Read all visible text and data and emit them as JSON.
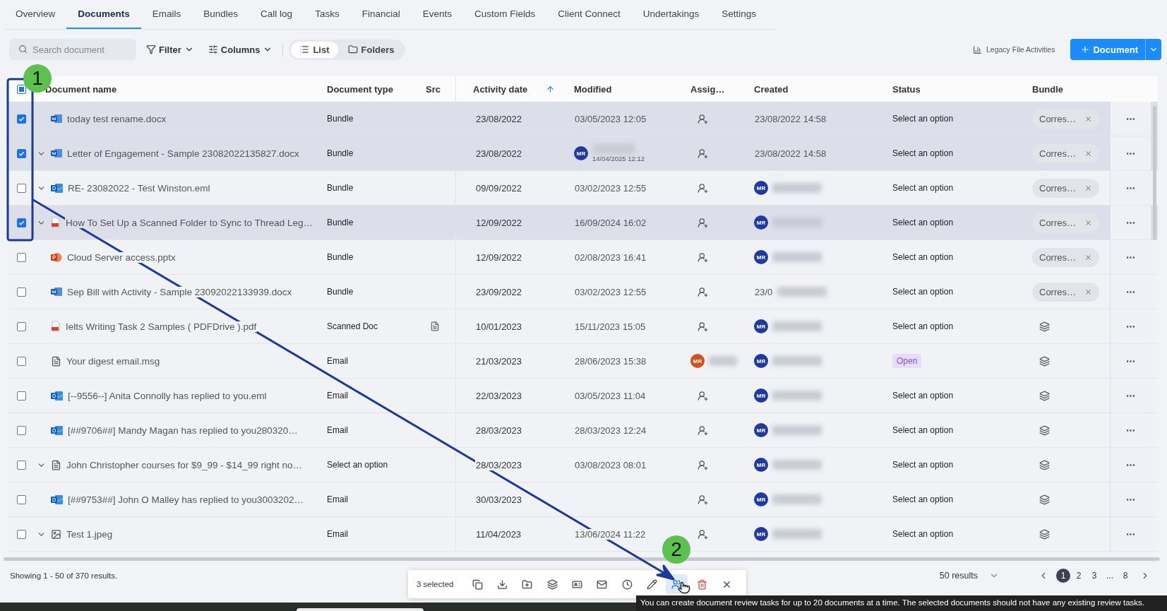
{
  "tabs": [
    {
      "label": "Overview",
      "selected": false
    },
    {
      "label": "Documents",
      "selected": true
    },
    {
      "label": "Emails",
      "selected": false
    },
    {
      "label": "Bundles",
      "selected": false
    },
    {
      "label": "Call log",
      "selected": false
    },
    {
      "label": "Tasks",
      "selected": false
    },
    {
      "label": "Financial",
      "selected": false
    },
    {
      "label": "Events",
      "selected": false
    },
    {
      "label": "Custom Fields",
      "selected": false
    },
    {
      "label": "Client Connect",
      "selected": false
    },
    {
      "label": "Undertakings",
      "selected": false
    },
    {
      "label": "Settings",
      "selected": false
    }
  ],
  "toolbar": {
    "search": {
      "placeholder": "Search document"
    },
    "filter": "Filter",
    "columns": "Columns",
    "views": [
      {
        "label": "List",
        "selected": true
      },
      {
        "label": "Folders",
        "selected": false
      }
    ],
    "legacy": "Legacy File Activities",
    "new_button": "Document"
  },
  "table": {
    "select_all": {
      "checked": true,
      "partial": true
    },
    "columns": [
      "Document name",
      "Document type",
      "Src",
      "Activity date",
      "Modified",
      "Assig…",
      "Created",
      "Status",
      "Bundle"
    ],
    "rows": [
      {
        "selected": true,
        "expandable": false,
        "kind": "word",
        "name": "today test rename.docx",
        "type": "Bundle",
        "src": false,
        "activity": "23/08/2022",
        "modified": {
          "kind": "plain",
          "text": "03/05/2023 12:05"
        },
        "assignee": {
          "kind": "add"
        },
        "created": {
          "kind": "plain",
          "text": "23/08/2022 14:58"
        },
        "status": {
          "kind": "select",
          "text": "Select an option"
        },
        "bundle": {
          "kind": "chip",
          "text": "Corres…"
        }
      },
      {
        "selected": true,
        "expandable": true,
        "kind": "word",
        "name": "Letter of Engagement - Sample 23082022135827.docx",
        "type": "Bundle",
        "src": false,
        "activity": "23/08/2022",
        "modified": {
          "kind": "user",
          "avatar": "MR",
          "text": "14/04/2025 12:12"
        },
        "assignee": {
          "kind": "add"
        },
        "created": {
          "kind": "plain",
          "text": "23/08/2022 14:58"
        },
        "status": {
          "kind": "select",
          "text": "Select an option"
        },
        "bundle": {
          "kind": "chip",
          "text": "Corres…"
        }
      },
      {
        "selected": false,
        "expandable": true,
        "kind": "outlook",
        "name": "RE- 23082022 - Test Winston.eml",
        "type": "Bundle",
        "src": false,
        "activity": "09/09/2022",
        "modified": {
          "kind": "plain",
          "text": "03/02/2023 12:55"
        },
        "assignee": {
          "kind": "add"
        },
        "created": {
          "kind": "user",
          "avatar": "MR"
        },
        "status": {
          "kind": "select",
          "text": "Select an option"
        },
        "bundle": {
          "kind": "chip",
          "text": "Corres…"
        }
      },
      {
        "selected": true,
        "expandable": true,
        "kind": "pdf",
        "name": "How To Set Up a Scanned Folder to Sync to Thread Leg…",
        "type": "Bundle",
        "src": false,
        "activity": "12/09/2022",
        "modified": {
          "kind": "plain",
          "text": "16/09/2024 16:02"
        },
        "assignee": {
          "kind": "add"
        },
        "created": {
          "kind": "user",
          "avatar": "MR"
        },
        "status": {
          "kind": "select",
          "text": "Select an option"
        },
        "bundle": {
          "kind": "chip",
          "text": "Corres…"
        }
      },
      {
        "selected": false,
        "expandable": false,
        "kind": "powerpoint",
        "name": "Cloud Server access.pptx",
        "type": "Bundle",
        "src": false,
        "activity": "12/09/2022",
        "modified": {
          "kind": "plain",
          "text": "02/08/2023 16:41"
        },
        "assignee": {
          "kind": "add"
        },
        "created": {
          "kind": "user",
          "avatar": "MR"
        },
        "status": {
          "kind": "select",
          "text": "Select an option"
        },
        "bundle": {
          "kind": "chip",
          "text": "Corres…"
        }
      },
      {
        "selected": false,
        "expandable": false,
        "kind": "word",
        "name": "Sep Bill with Activity - Sample 23092022133939.docx",
        "type": "Bundle",
        "src": false,
        "activity": "23/09/2022",
        "modified": {
          "kind": "plain",
          "text": "03/02/2023 12:55"
        },
        "assignee": {
          "kind": "add"
        },
        "created": {
          "kind": "partial",
          "text": "23/0"
        },
        "status": {
          "kind": "select",
          "text": "Select an option"
        },
        "bundle": {
          "kind": "chip",
          "text": "Corres…"
        }
      },
      {
        "selected": false,
        "expandable": false,
        "kind": "pdf",
        "name": "Ielts Writing Task 2 Samples ( PDFDrive ).pdf",
        "type": "Scanned Doc",
        "src": true,
        "activity": "10/01/2023",
        "modified": {
          "kind": "plain",
          "text": "15/11/2023 15:05"
        },
        "assignee": {
          "kind": "add"
        },
        "created": {
          "kind": "user",
          "avatar": "MR"
        },
        "status": {
          "kind": "select",
          "text": "Select an option"
        },
        "bundle": {
          "kind": "icon"
        }
      },
      {
        "selected": false,
        "expandable": false,
        "kind": "file",
        "name": "Your digest email.msg",
        "type": "Email",
        "src": false,
        "activity": "21/03/2023",
        "modified": {
          "kind": "plain",
          "text": "28/06/2023 15:38"
        },
        "assignee": {
          "kind": "user",
          "avatar": "MR",
          "color": "#d2521a"
        },
        "created": {
          "kind": "user",
          "avatar": "MR"
        },
        "status": {
          "kind": "badge",
          "text": "Open"
        },
        "bundle": {
          "kind": "icon"
        }
      },
      {
        "selected": false,
        "expandable": false,
        "kind": "outlook",
        "name": "[--9556--] Anita Connolly has replied to you.eml",
        "type": "Email",
        "src": false,
        "activity": "22/03/2023",
        "modified": {
          "kind": "plain",
          "text": "03/05/2023 11:04"
        },
        "assignee": {
          "kind": "add"
        },
        "created": {
          "kind": "user",
          "avatar": "MR"
        },
        "status": {
          "kind": "select",
          "text": "Select an option"
        },
        "bundle": {
          "kind": "icon"
        }
      },
      {
        "selected": false,
        "expandable": false,
        "kind": "outlook",
        "name": "[##9706##] Mandy Magan has replied to you280320…",
        "type": "Email",
        "src": false,
        "activity": "28/03/2023",
        "modified": {
          "kind": "plain",
          "text": "28/03/2023 12:24"
        },
        "assignee": {
          "kind": "add"
        },
        "created": {
          "kind": "user",
          "avatar": "MR"
        },
        "status": {
          "kind": "select",
          "text": "Select an option"
        },
        "bundle": {
          "kind": "icon"
        }
      },
      {
        "selected": false,
        "expandable": true,
        "kind": "file",
        "name": "John Christopher courses for $9_99 - $14_99 right no…",
        "type": "Select an option",
        "src": false,
        "activity": "28/03/2023",
        "modified": {
          "kind": "plain",
          "text": "03/08/2023 08:01"
        },
        "assignee": {
          "kind": "add"
        },
        "created": {
          "kind": "user",
          "avatar": "MR"
        },
        "status": {
          "kind": "select",
          "text": "Select an option"
        },
        "bundle": {
          "kind": "icon"
        }
      },
      {
        "selected": false,
        "expandable": false,
        "kind": "outlook",
        "name": "[##9753##] John O Malley has replied to you3003202…",
        "type": "Email",
        "src": false,
        "activity": "30/03/2023",
        "modified": {
          "kind": "none"
        },
        "assignee": {
          "kind": "add"
        },
        "created": {
          "kind": "user",
          "avatar": "MR"
        },
        "status": {
          "kind": "select",
          "text": "Select an option"
        },
        "bundle": {
          "kind": "icon"
        }
      },
      {
        "selected": false,
        "expandable": true,
        "kind": "image",
        "name": "Test 1.jpeg",
        "type": "Email",
        "src": false,
        "activity": "11/04/2023",
        "modified": {
          "kind": "plain",
          "text": "13/06/2024 11:22"
        },
        "assignee": {
          "kind": "add"
        },
        "created": {
          "kind": "user",
          "avatar": "MR"
        },
        "status": {
          "kind": "select",
          "text": "Select an option"
        },
        "bundle": {
          "kind": "icon"
        }
      }
    ]
  },
  "footer": {
    "showing": "Showing 1 - 50 of 370 results.",
    "per_page": "50 results",
    "pages": [
      {
        "label": "1",
        "selected": true
      },
      {
        "label": "2",
        "selected": false
      },
      {
        "label": "3",
        "selected": false
      },
      {
        "label": "...",
        "selected": false
      },
      {
        "label": "8",
        "selected": false
      }
    ]
  },
  "bulk_bar": {
    "count": "3 selected",
    "actions": [
      {
        "kind": "copy",
        "highlighted": false
      },
      {
        "kind": "download",
        "highlighted": false
      },
      {
        "kind": "folder",
        "highlighted": false
      },
      {
        "kind": "layers",
        "highlighted": false
      },
      {
        "kind": "card",
        "highlighted": false
      },
      {
        "kind": "mail",
        "highlighted": false
      },
      {
        "kind": "clock",
        "highlighted": false
      },
      {
        "kind": "edit",
        "highlighted": false
      },
      {
        "kind": "review",
        "highlighted": true
      },
      {
        "kind": "delete",
        "highlighted": false
      },
      {
        "kind": "close",
        "highlighted": false
      }
    ]
  },
  "tooltip": "You can create document review tasks for up to 20 documents at a time. The selected documents should not have any existing review tasks.",
  "annotations": [
    {
      "label": "1"
    },
    {
      "label": "2"
    }
  ]
}
